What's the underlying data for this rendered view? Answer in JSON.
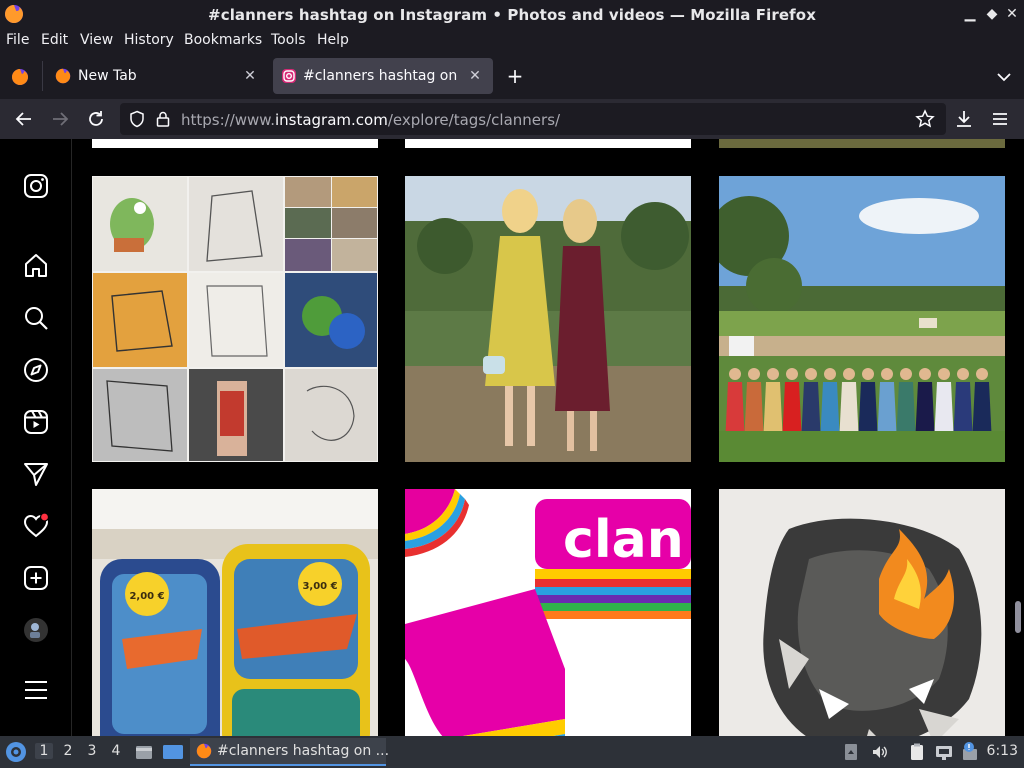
{
  "window": {
    "title": "#clanners hashtag on Instagram • Photos and videos — Mozilla Firefox"
  },
  "menu": [
    "File",
    "Edit",
    "View",
    "History",
    "Bookmarks",
    "Tools",
    "Help"
  ],
  "tabs": [
    {
      "label": "New Tab",
      "active": false
    },
    {
      "label": "#clanners hashtag on Inst",
      "active": true
    }
  ],
  "nav": {
    "url_prefix": "https://www.",
    "url_host": "instagram.com",
    "url_path": "/explore/tags/clanners/"
  },
  "instagram": {
    "sidebar": [
      "instagram-logo-icon",
      "home-icon",
      "search-icon",
      "explore-icon",
      "reels-icon",
      "messages-icon",
      "notifications-icon",
      "create-icon",
      "profile-avatar",
      "more-menu-icon"
    ],
    "posts": [
      {
        "name": "post-sketches-collage"
      },
      {
        "name": "post-two-women-vineyard"
      },
      {
        "name": "post-group-vineyard"
      },
      {
        "name": "post-planes-backpacks"
      },
      {
        "name": "post-clan-logo"
      },
      {
        "name": "post-burning-paper"
      }
    ],
    "post_texts": {
      "clan_logo": "clan",
      "backpack_price_left": "2,00 €",
      "backpack_price_right": "3,00 €"
    }
  },
  "taskbar": {
    "workspaces": [
      "1",
      "2",
      "3",
      "4"
    ],
    "active_task": "#clanners hashtag on ...",
    "clock": "6:13"
  },
  "colors": {
    "instagram_notification": "#ff3040",
    "taskbar_accent": "#5294e2"
  }
}
